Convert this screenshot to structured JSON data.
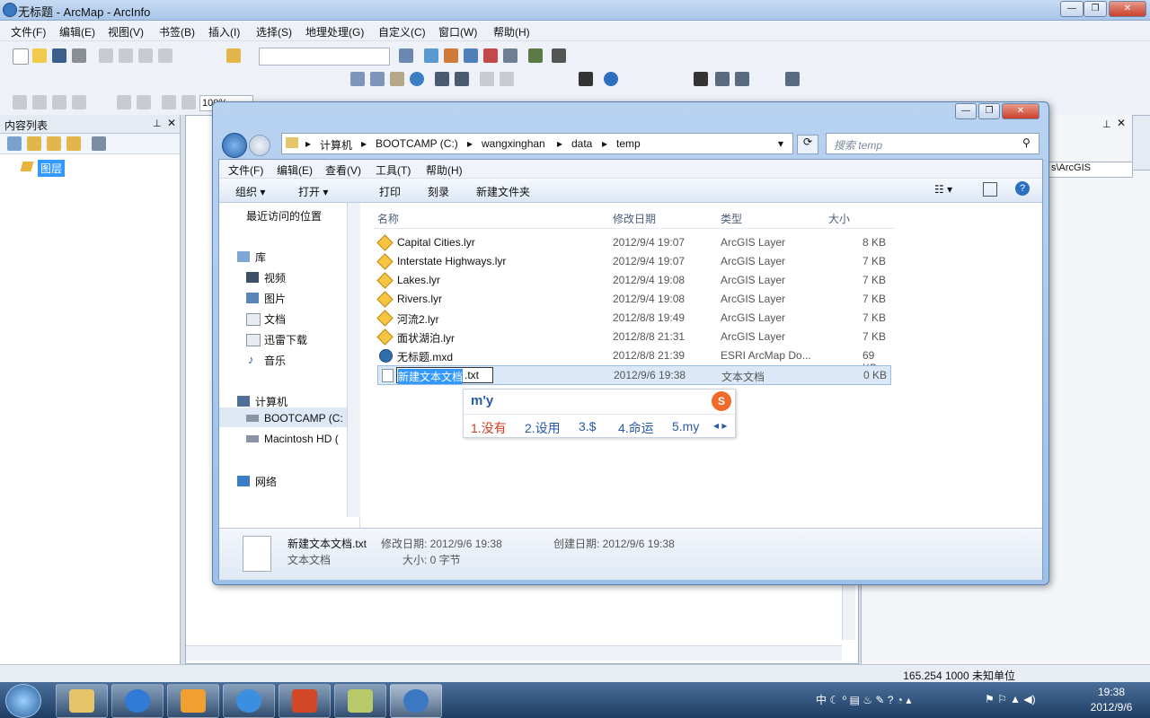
{
  "arcmap": {
    "title": "无标题 - ArcMap - ArcInfo",
    "menu": [
      "文件(F)",
      "编辑(E)",
      "视图(V)",
      "书签(B)",
      "插入(I)",
      "选择(S)",
      "地理处理(G)",
      "自定义(C)",
      "窗口(W)",
      "帮助(H)"
    ],
    "toc_title": "内容列表",
    "toc_layer": "图层",
    "zoom_value": "100%",
    "status_text": "165.254  1000 未知单位",
    "right_label": "s\\ArcGIS"
  },
  "explorer": {
    "address": [
      "计算机",
      "BOOTCAMP (C:)",
      "wangxinghan",
      "data",
      "temp"
    ],
    "search_placeholder": "搜索 temp",
    "menu": [
      "文件(F)",
      "编辑(E)",
      "查看(V)",
      "工具(T)",
      "帮助(H)"
    ],
    "commands": {
      "organize": "组织 ▾",
      "open": "打开 ▾",
      "print": "打印",
      "burn": "刻录",
      "new_folder": "新建文件夹"
    },
    "nav": {
      "recent": "最近访问的位置",
      "library": "库",
      "video": "视频",
      "pictures": "图片",
      "documents": "文档",
      "xunlei": "迅雷下载",
      "music": "音乐",
      "computer": "计算机",
      "bootcamp": "BOOTCAMP (C:",
      "mac": "Macintosh HD (",
      "network": "网络"
    },
    "columns": {
      "name": "名称",
      "modified": "修改日期",
      "type": "类型",
      "size": "大小"
    },
    "files": [
      {
        "name": "Capital Cities.lyr",
        "modified": "2012/9/4 19:07",
        "type": "ArcGIS Layer",
        "size": "8 KB"
      },
      {
        "name": "Interstate Highways.lyr",
        "modified": "2012/9/4 19:07",
        "type": "ArcGIS Layer",
        "size": "7 KB"
      },
      {
        "name": "Lakes.lyr",
        "modified": "2012/9/4 19:08",
        "type": "ArcGIS Layer",
        "size": "7 KB"
      },
      {
        "name": "Rivers.lyr",
        "modified": "2012/9/4 19:08",
        "type": "ArcGIS Layer",
        "size": "7 KB"
      },
      {
        "name": "河流2.lyr",
        "modified": "2012/8/8 19:49",
        "type": "ArcGIS Layer",
        "size": "7 KB"
      },
      {
        "name": "面状湖泊.lyr",
        "modified": "2012/8/8 21:31",
        "type": "ArcGIS Layer",
        "size": "7 KB"
      },
      {
        "name": "无标题.mxd",
        "modified": "2012/8/8 21:39",
        "type": "ESRI ArcMap Do...",
        "size": "69 KB"
      }
    ],
    "editing_file": {
      "name_selected": "新建文本文档",
      "name_ext": ".txt",
      "modified": "2012/9/6 19:38",
      "type": "文本文档",
      "size": "0 KB"
    },
    "details": {
      "name": "新建文本文档.txt",
      "type": "文本文档",
      "modified_label": "修改日期: 2012/9/6 19:38",
      "created_label": "创建日期: 2012/9/6 19:38",
      "size_label": "大小: 0 字节"
    }
  },
  "ime": {
    "input": "m'y",
    "candidates": [
      "1.没有",
      "2.设用",
      "3.$",
      "4.命运",
      "5.my"
    ]
  },
  "taskbar": {
    "time": "19:38",
    "date": "2012/9/6"
  }
}
